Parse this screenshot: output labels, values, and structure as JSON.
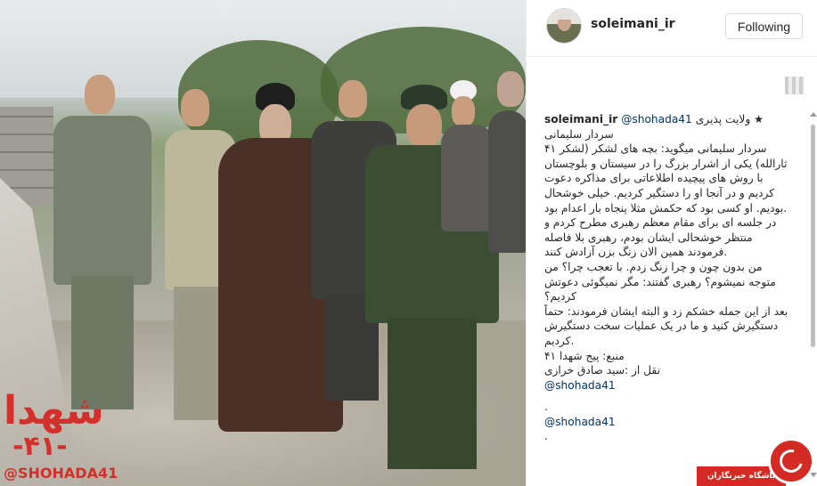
{
  "header": {
    "username": "soleimani_ir",
    "follow_label": "Following"
  },
  "caption": {
    "line1_title": "ولایت پذیری ★",
    "line1_username": "soleimani_ir",
    "line1_mention": "@shohada41",
    "body": [
      "سردار سلیمانی",
      "سردار سلیمانی میگوید: بچه های لشکر (لشکر ۴۱",
      "ثارالله) یکی از اشرار بزرگ را در سیستان و بلوچستان",
      "با روش های پیچیده اطلاعاتی برای مذاکره دعوت",
      "کردیم و در آنجا او را دستگیر کردیم. خیلی خوشحال",
      ".بودیم. او کسی بود که حکمش مثلا پنجاه بار اعدام بود",
      "در جلسه ای برای مقام معظم رهبری مطرح کردم و",
      "منتظر خوشحالی ایشان بودم، رهبری بلا فاصله",
      ".فرمودند همین الان زنگ بزن آزادش کنند",
      "من بدون چون و چرا زنگ زدم. با تعجب چرا؟ من",
      "متوجه نمیشوم؟ رهبری گفتند: مگر نمیگوئی دعوتش",
      "کردیم؟",
      "بعد از این جمله خشکم زد و البته ایشان فرمودند: حتماً",
      "دستگیرش کنید و ما در یک عملیات سخت دستگیرش",
      ".کردیم",
      "منبع: پیج شهدا ۴۱",
      "نقل از :سید صادق خرازی"
    ],
    "mention_after": "@shohada41",
    "dot": ".",
    "mention_last": "@shohada41",
    "trailing_dot": "."
  },
  "photo": {
    "overlay_line1": "شهدا",
    "overlay_line2": "-۴۱-",
    "overlay_line3": "@SHOHADA41"
  },
  "watermark": {
    "label": "باشگاه خبرنگاران"
  }
}
